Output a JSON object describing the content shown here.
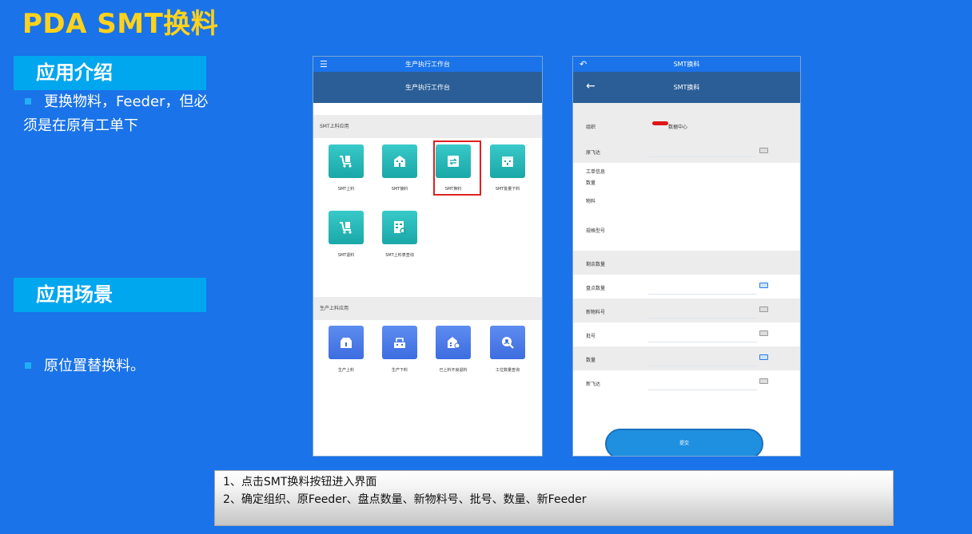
{
  "slide": {
    "title": "PDA SMT换料",
    "intro_header": "应用介绍",
    "intro_text": "更换物料，Feeder，但必须是在原有工单下",
    "scene_header": "应用场景",
    "scene_text": "原位置替换料。"
  },
  "phone1": {
    "status_title": "生产执行工作台",
    "header_title": "生产执行工作台",
    "section1_label": "SMT上料应用",
    "section1_tiles": [
      {
        "label": "SMT上料",
        "icon": "cart-icon"
      },
      {
        "label": "SMT接料",
        "icon": "building-icon"
      },
      {
        "label": "SMT换料",
        "icon": "swap-icon"
      },
      {
        "label": "SMT批量下料",
        "icon": "calendar-icon"
      },
      {
        "label": "SMT退料",
        "icon": "cart-icon"
      },
      {
        "label": "SMT上料表查询",
        "icon": "search-doc-icon"
      }
    ],
    "section2_label": "生产上料应用",
    "section2_tiles": [
      {
        "label": "生产上料",
        "icon": "box-icon"
      },
      {
        "label": "生产下料",
        "icon": "tray-icon"
      },
      {
        "label": "已上料不良退料",
        "icon": "return-icon"
      },
      {
        "label": "工位数量查询",
        "icon": "magnifier-icon"
      }
    ]
  },
  "phone2": {
    "status_title": "SMT换料",
    "header_title": "SMT换料",
    "fields": {
      "org_label": "组织",
      "org_value": "数据中心",
      "old_feeder_label": "原飞达",
      "work_order_label": "工单信息",
      "quantity_label": "数量",
      "material_label": "物料",
      "spec_label": "规格型号",
      "remaining_label": "剩余数量",
      "count_label": "盘点数量",
      "new_material_label": "新物料号",
      "batch_label": "批号",
      "qty_label": "数量",
      "new_feeder_label": "新飞达"
    },
    "submit_label": "提交"
  },
  "caption": {
    "line1": "1、点击SMT换料按钮进入界面",
    "line2": "2、确定组织、原Feeder、盘点数量、新物料号、批号、数量、新Feeder"
  }
}
